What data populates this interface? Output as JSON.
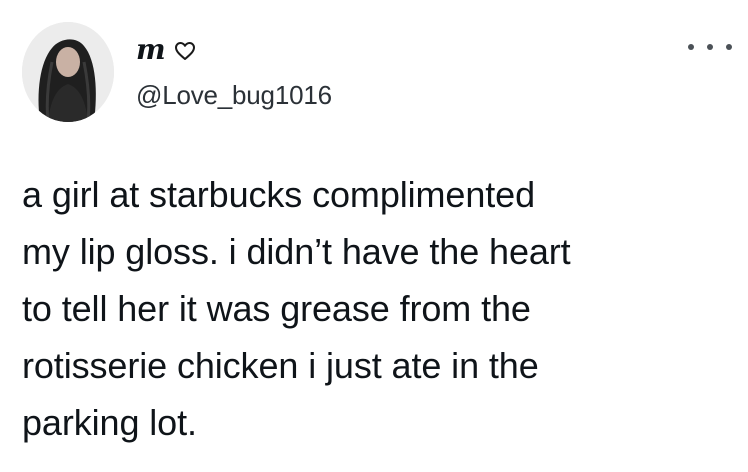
{
  "author": {
    "display_name": "m",
    "name_emoji_icon": "heart-outline-icon",
    "handle": "@Love_bug1016",
    "avatar_icon": "profile-photo-avatar"
  },
  "actions": {
    "more_icon": "more-horizontal-icon"
  },
  "tweet": {
    "text": "a girl at starbucks complimented\nmy lip gloss. i didn’t have the heart\nto tell her it was grease from the\nrotisserie chicken i just ate in the\nparking lot."
  },
  "colors": {
    "text": "#0f1419",
    "secondary_text": "#2b3137",
    "background": "#ffffff"
  }
}
